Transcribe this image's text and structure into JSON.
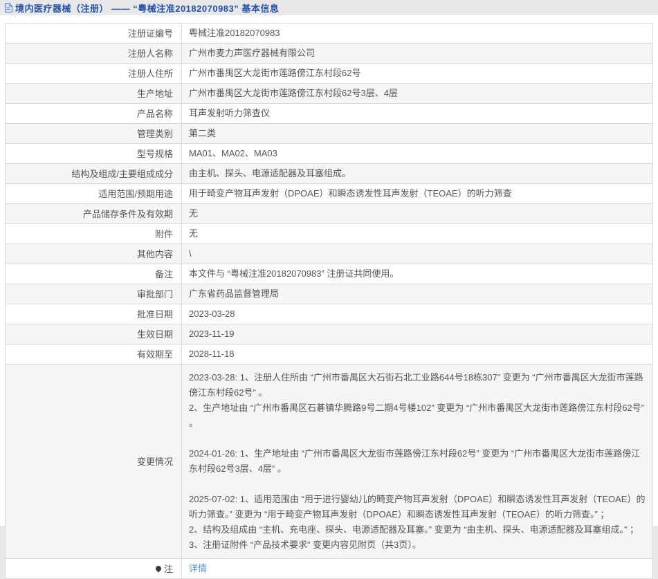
{
  "page": {
    "title": "境内医疗器械（注册） —— “粤械注准20182070983” 基本信息",
    "title_color": "#2150a5",
    "title_icon": "document-icon",
    "background_color": "#e8e8e9",
    "link_color": "#5191d1",
    "alt_row_color": "#f5f5f5"
  },
  "table": {
    "rows": [
      {
        "label": "注册证编号",
        "value": "粤械注准20182070983"
      },
      {
        "label": "注册人名称",
        "value": "广州市麦力声医疗器械有限公司"
      },
      {
        "label": "注册人住所",
        "value": "广州市番禺区大龙街市莲路傍江东村段62号"
      },
      {
        "label": "生产地址",
        "value": "广州市番禺区大龙街市莲路傍江东村段62号3层、4层"
      },
      {
        "label": "产品名称",
        "value": "耳声发射听力筛查仪"
      },
      {
        "label": "管理类别",
        "value": "第二类"
      },
      {
        "label": "型号规格",
        "value": "MA01、MA02、MA03"
      },
      {
        "label": "结构及组成/主要组成成分",
        "value": "由主机、探头、电源适配器及耳塞组成。"
      },
      {
        "label": "适用范围/预期用途",
        "value": "用于畸变产物耳声发射（DPOAE）和瞬态诱发性耳声发射（TEOAE）的听力筛查"
      },
      {
        "label": "产品储存条件及有效期",
        "value": "无"
      },
      {
        "label": "附件",
        "value": "无"
      },
      {
        "label": "其他内容",
        "value": "\\"
      },
      {
        "label": "备注",
        "value": "本文件与 “粤械注准20182070983” 注册证共同使用。"
      },
      {
        "label": "审批部门",
        "value": "广东省药品监督管理局"
      },
      {
        "label": "批准日期",
        "value": "2023-03-28"
      },
      {
        "label": "生效日期",
        "value": "2023-11-19"
      },
      {
        "label": "有效期至",
        "value": "2028-11-18"
      },
      {
        "label": "变更情况",
        "tall": true,
        "value": "2023-03-28: 1、注册人住所由 “广州市番禺区大石街石北工业路644号18栋307” 变更为 “广州市番禺区大龙街市莲路傍江东村段62号” 。\n2、生产地址由 “广州市番禺区石碁镇华腾路9号二期4号楼102” 变更为 “广州市番禺区大龙街市莲路傍江东村段62号” 。\n\n2024-01-26: 1、生产地址由 “广州市番禺区大龙街市莲路傍江东村段62号” 变更为 “广州市番禺区大龙街市莲路傍江东村段62号3层、4层” 。\n\n2025-07-02: 1、适用范围由 “用于进行婴幼儿的畸变产物耳声发射（DPOAE）和瞬态诱发性耳声发射（TEOAE）的听力筛查。” 变更为 “用于畸变产物耳声发射（DPOAE）和瞬态诱发性耳声发射（TEOAE）的听力筛查。” ；\n2、结构及组成由 “主机、充电座、探头、电源适配器及耳塞。” 变更为 “由主机、探头、电源适配器及耳塞组成。” ；\n3、注册证附件 “产品技术要求” 变更内容见附页（共3页）。"
      },
      {
        "label": "注",
        "value": "详情",
        "link": true,
        "icon": "note-icon"
      }
    ]
  }
}
